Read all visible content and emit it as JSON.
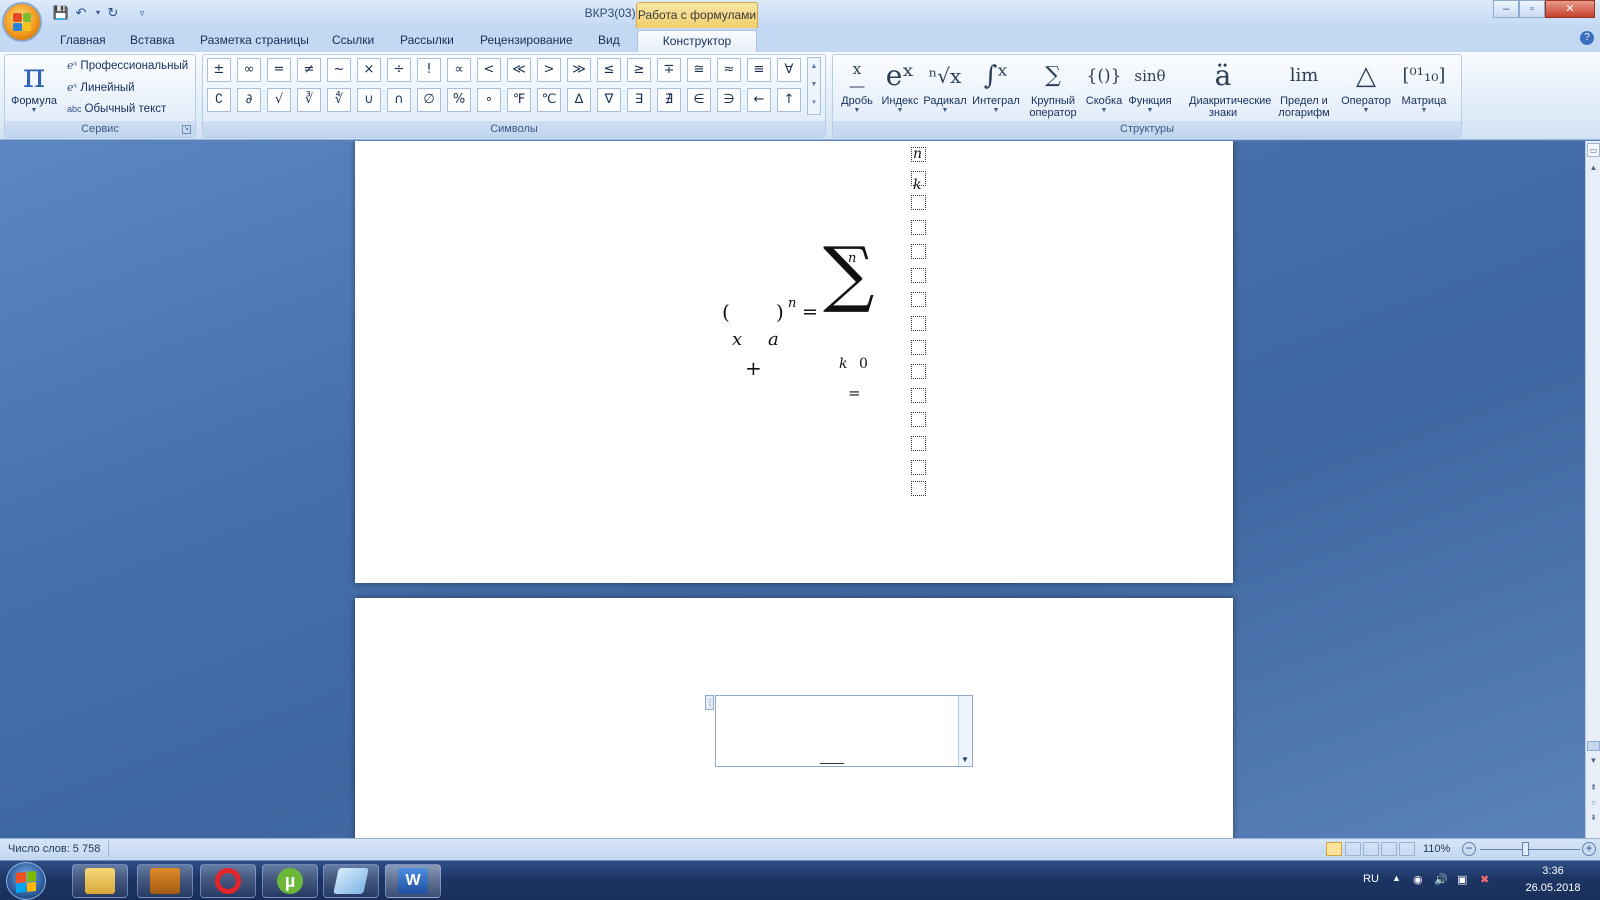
{
  "titlebar": {
    "document_title": "ВКР3(03).docx - Microsoft Word",
    "context_tab_title": "Работа с формулами",
    "minimize": "‒",
    "maximize": "▫",
    "close": "✕"
  },
  "tabs": [
    {
      "label": "Главная"
    },
    {
      "label": "Вставка"
    },
    {
      "label": "Разметка страницы"
    },
    {
      "label": "Ссылки"
    },
    {
      "label": "Рассылки"
    },
    {
      "label": "Рецензирование"
    },
    {
      "label": "Вид"
    },
    {
      "label": "Конструктор",
      "active": true
    }
  ],
  "ribbon": {
    "service": {
      "group_label": "Сервис",
      "formula_label": "Формула",
      "items": [
        {
          "label": "Профессиональный",
          "icon": "professional-format-icon"
        },
        {
          "label": "Линейный",
          "icon": "linear-format-icon"
        },
        {
          "label": "Обычный текст",
          "icon": "plain-text-icon"
        }
      ]
    },
    "symbols": {
      "group_label": "Символы",
      "row1": [
        "±",
        "∞",
        "=",
        "≠",
        "~",
        "×",
        "÷",
        "!",
        "∝",
        "<",
        "≪",
        ">",
        "≫",
        "≤",
        "≥",
        "∓",
        "≅",
        "≈",
        "≡",
        "∀"
      ],
      "row2": [
        "∁",
        "∂",
        "√",
        "∛",
        "∜",
        "∪",
        "∩",
        "∅",
        "%",
        "∘",
        "℉",
        "℃",
        "∆",
        "∇",
        "∃",
        "∄",
        "∈",
        "∋",
        "←",
        "↑"
      ]
    },
    "structures": {
      "group_label": "Структуры",
      "buttons": [
        {
          "glyph": "x/y",
          "label": "Дробь"
        },
        {
          "glyph": "eˣ",
          "label": "Индекс"
        },
        {
          "glyph": "ⁿ√x",
          "label": "Радикал"
        },
        {
          "glyph": "∫",
          "label": "Интеграл"
        },
        {
          "glyph": "∑",
          "label": "Крупный оператор"
        },
        {
          "glyph": "{()}",
          "label": "Скобка"
        },
        {
          "glyph": "sinθ",
          "label": "Функция"
        },
        {
          "glyph": "ä",
          "label": "Диакритические знаки"
        },
        {
          "glyph": "lim",
          "label": "Предел и логарифм"
        },
        {
          "glyph": "△",
          "label": "Оператор"
        },
        {
          "glyph": "[1 0; 0 1]",
          "label": "Матрица"
        }
      ]
    }
  },
  "equation": {
    "open_paren": "(",
    "close_paren": ")",
    "exp_n": "n",
    "equals": "=",
    "sigma": "∑",
    "upper_limit": "n",
    "x": "x",
    "a": "a",
    "plus": "+",
    "k": "k",
    "zero": "0",
    "eq_below": "=",
    "col_n": "n",
    "col_k": "k"
  },
  "statusbar": {
    "word_count": "Число слов: 5 758",
    "zoom": "110%"
  },
  "taskbar": {
    "language": "RU",
    "time": "3:36",
    "date": "26.05.2018"
  }
}
